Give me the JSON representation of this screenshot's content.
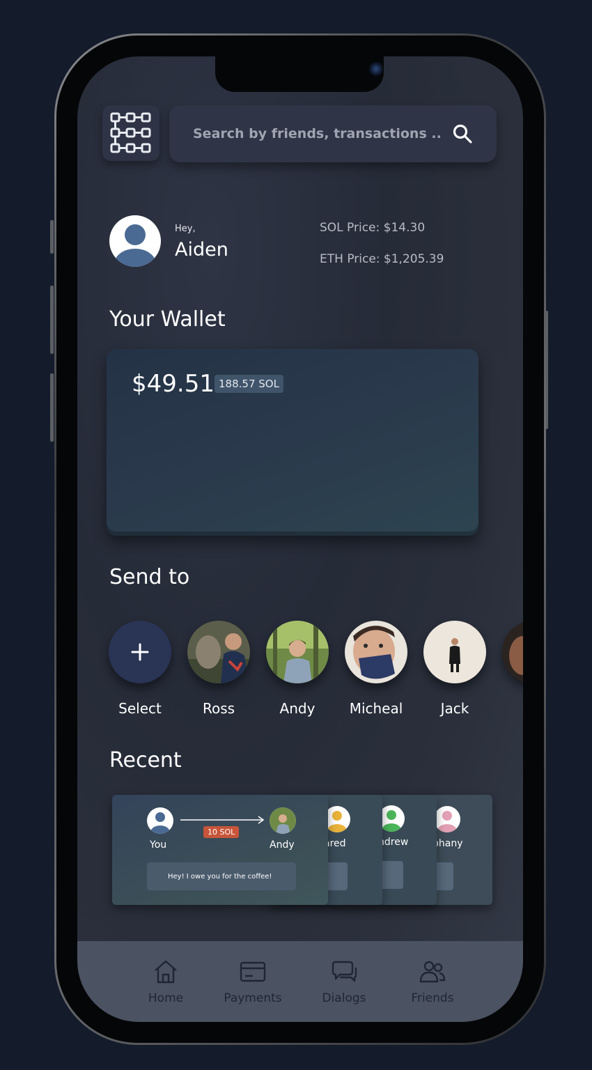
{
  "search": {
    "placeholder": "Search by friends, transactions .."
  },
  "greeting": {
    "hey": "Hey,",
    "name": "Aiden"
  },
  "prices": {
    "sol": "SOL Price: $14.30",
    "eth": "ETH Price: $1,205.39"
  },
  "wallet": {
    "title": "Your Wallet",
    "usd": "$49.51",
    "sol": "188.57 SOL"
  },
  "send_to": {
    "title": "Send to",
    "contacts": [
      {
        "name": "Select",
        "icon": "plus-icon"
      },
      {
        "name": "Ross"
      },
      {
        "name": "Andy"
      },
      {
        "name": "Micheal"
      },
      {
        "name": "Jack"
      }
    ]
  },
  "recent": {
    "title": "Recent",
    "card": {
      "from": "You",
      "to": "Andy",
      "amount": "10 SOL",
      "note": "Hey! I owe you for the coffee!"
    },
    "stacked": [
      "ared",
      "ndrew",
      "phany"
    ]
  },
  "nav": [
    {
      "label": "Home",
      "icon": "home-icon"
    },
    {
      "label": "Payments",
      "icon": "card-icon"
    },
    {
      "label": "Dialogs",
      "icon": "chat-icon"
    },
    {
      "label": "Friends",
      "icon": "people-icon"
    }
  ],
  "colors": {
    "background": "#141b2b",
    "screen": "#262b38",
    "accent_badge": "#c8553a",
    "nav": "#4b5262"
  }
}
